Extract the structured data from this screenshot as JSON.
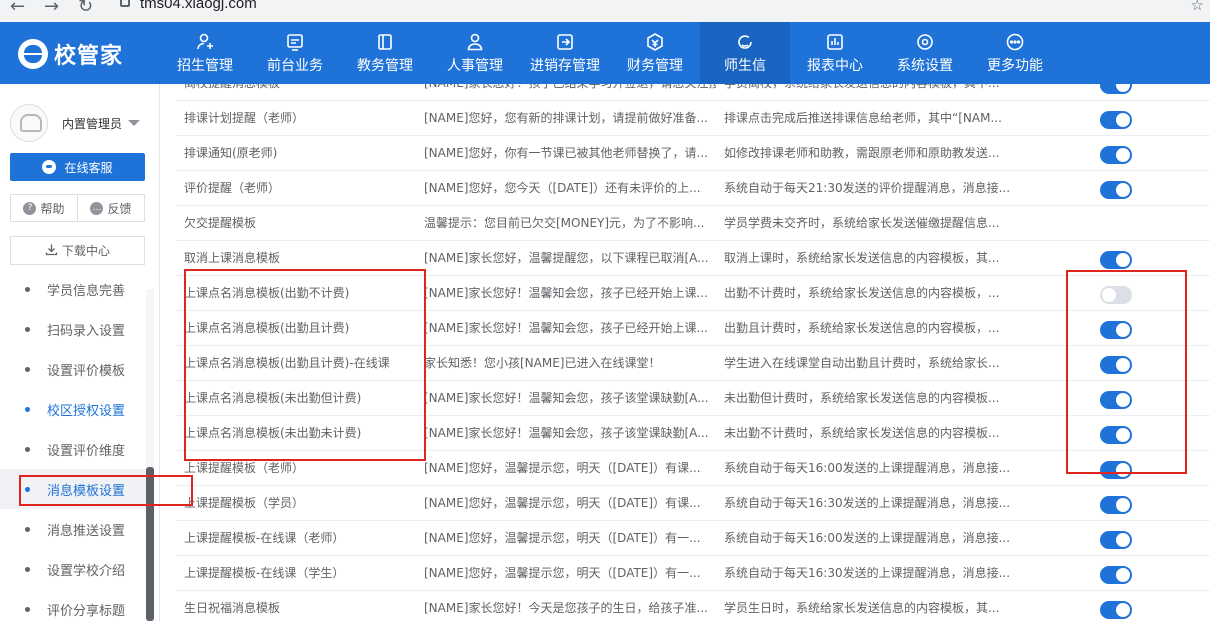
{
  "browser": {
    "url": "tms04.xiaogj.com",
    "back_icon": "back-arrow-icon",
    "forward_icon": "forward-arrow-icon",
    "reload_icon": "reload-icon",
    "star_icon": "star-icon"
  },
  "app": {
    "logo_text": "校管家",
    "brand_color": "#1f73d8"
  },
  "nav": [
    {
      "label": "招生管理",
      "icon": "person-add-icon"
    },
    {
      "label": "前台业务",
      "icon": "monitor-icon"
    },
    {
      "label": "教务管理",
      "icon": "book-icon"
    },
    {
      "label": "人事管理",
      "icon": "person-icon"
    },
    {
      "label": "进销存管理",
      "icon": "inventory-icon"
    },
    {
      "label": "财务管理",
      "icon": "finance-icon"
    },
    {
      "label": "师生信",
      "icon": "message-icon",
      "active": true
    },
    {
      "label": "报表中心",
      "icon": "chart-icon"
    },
    {
      "label": "系统设置",
      "icon": "settings-icon"
    },
    {
      "label": "更多功能",
      "icon": "more-icon"
    }
  ],
  "sidebar": {
    "user_name": "内置管理员",
    "online_service": "在线客服",
    "help": "帮助",
    "feedback": "反馈",
    "download_center": "下载中心",
    "menu": [
      {
        "label": "学员信息完善"
      },
      {
        "label": "扫码录入设置"
      },
      {
        "label": "设置评价模板"
      },
      {
        "label": "校区授权设置",
        "highlight": true
      },
      {
        "label": "设置评价维度"
      },
      {
        "label": "消息模板设置",
        "current": true
      },
      {
        "label": "消息推送设置"
      },
      {
        "label": "设置学校介绍"
      },
      {
        "label": "评价分享标题"
      }
    ]
  },
  "table": {
    "rows": [
      {
        "name": "离校提醒消息模板",
        "content": "[NAME]家长您好！孩子已结束学习并签退，请您关注接送...",
        "desc": "学员离校，系统给家长发送信息的内容模板，其中...",
        "enabled": true
      },
      {
        "name": "排课计划提醒（老师）",
        "content": "[NAME]您好，您有新的排课计划，请提前做好准备...",
        "desc": "排课点击完成后推送排课信息给老师，其中“[NAM...",
        "enabled": true
      },
      {
        "name": "排课通知(原老师)",
        "content": "[NAME]您好，你有一节课已被其他老师替换了，请...",
        "desc": "如修改排课老师和助教，需跟原老师和原助教发送...",
        "enabled": true
      },
      {
        "name": "评价提醒（老师）",
        "content": "[NAME]您好，您今天（[DATE]）还有未评价的上...",
        "desc": "系统自动于每天21:30发送的评价提醒消息，消息接...",
        "enabled": true
      },
      {
        "name": "欠交提醒模板",
        "content": "温馨提示：您目前已欠交[MONEY]元，为了不影响...",
        "desc": "学员学费未交齐时，系统给家长发送催缴提醒信息...",
        "enabled": null
      },
      {
        "name": "取消上课消息模板",
        "content": "[NAME]家长您好，温馨提醒您，以下课程已取消[A...",
        "desc": "取消上课时，系统给家长发送信息的内容模板，其...",
        "enabled": true
      },
      {
        "name": "上课点名消息模板(出勤不计费)",
        "content": "[NAME]家长您好！温馨知会您，孩子已经开始上课...",
        "desc": "出勤不计费时，系统给家长发送信息的内容模板，...",
        "enabled": false
      },
      {
        "name": "上课点名消息模板(出勤且计费)",
        "content": "[NAME]家长您好！温馨知会您，孩子已经开始上课...",
        "desc": "出勤且计费时，系统给家长发送信息的内容模板，...",
        "enabled": true
      },
      {
        "name": "上课点名消息模板(出勤且计费)-在线课",
        "content": "家长知悉！您小孩[NAME]已进入在线课堂！",
        "desc": "学生进入在线课堂自动出勤且计费时，系统给家长...",
        "enabled": true
      },
      {
        "name": "上课点名消息模板(未出勤但计费)",
        "content": "[NAME]家长您好！温馨知会您，孩子该堂课缺勤[A...",
        "desc": "未出勤但计费时，系统给家长发送信息的内容模板...",
        "enabled": true
      },
      {
        "name": "上课点名消息模板(未出勤未计费)",
        "content": "[NAME]家长您好！温馨知会您，孩子该堂课缺勤[A...",
        "desc": "未出勤不计费时，系统给家长发送信息的内容模板...",
        "enabled": true
      },
      {
        "name": "上课提醒模板（老师）",
        "content": "[NAME]您好，温馨提示您，明天（[DATE]）有课...",
        "desc": "系统自动于每天16:00发送的上课提醒消息，消息接...",
        "enabled": true
      },
      {
        "name": "上课提醒模板（学员）",
        "content": "[NAME]您好，温馨提示您，明天（[DATE]）有课...",
        "desc": "系统自动于每天16:30发送的上课提醒消息，消息接...",
        "enabled": true
      },
      {
        "name": "上课提醒模板-在线课（老师）",
        "content": "[NAME]您好，温馨提示您，明天（[DATE]）有一...",
        "desc": "系统自动于每天16:00发送的上课提醒消息，消息接...",
        "enabled": true
      },
      {
        "name": "上课提醒模板-在线课（学生）",
        "content": "[NAME]您好，温馨提示您，明天（[DATE]）有一...",
        "desc": "系统自动于每天16:30发送的上课提醒消息，消息接...",
        "enabled": true
      },
      {
        "name": "生日祝福消息模板",
        "content": "[NAME]家长您好！今天是您孩子的生日，给孩子准...",
        "desc": "学员生日时，系统给家长发送信息的内容模板，其...",
        "enabled": true
      }
    ]
  },
  "annotation_color": "#e0251f"
}
